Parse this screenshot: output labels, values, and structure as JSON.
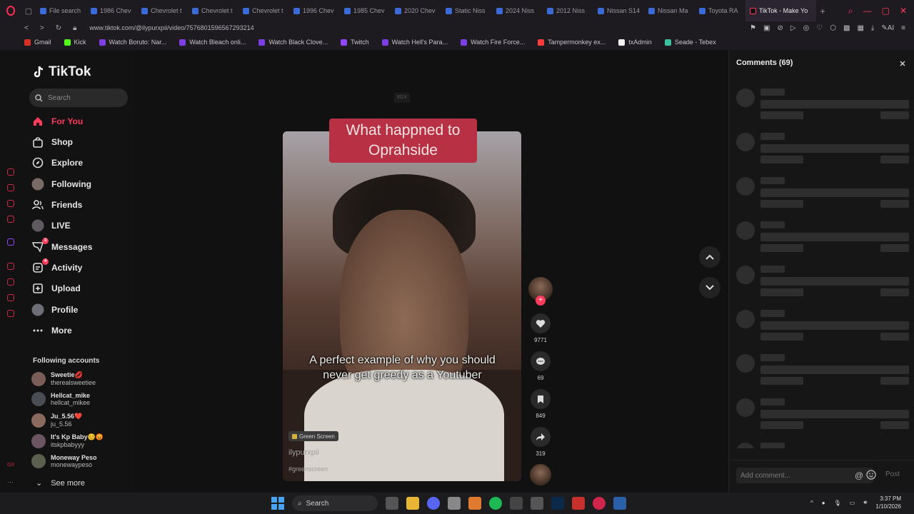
{
  "browser": {
    "tabs": [
      {
        "label": "File search"
      },
      {
        "label": "1986 Chev"
      },
      {
        "label": "Chevrolet t"
      },
      {
        "label": "Chevrolet t"
      },
      {
        "label": "Chevrolet t"
      },
      {
        "label": "1996 Chev"
      },
      {
        "label": "1985 Chev"
      },
      {
        "label": "2020 Chev"
      },
      {
        "label": "Static Niss"
      },
      {
        "label": "2024 Niss"
      },
      {
        "label": "2012 Niss"
      },
      {
        "label": "Nissan S14"
      },
      {
        "label": "Nissan Ma"
      },
      {
        "label": "Toyota RA"
      }
    ],
    "active_tab": "TikTok - Make Yo",
    "url": "www.tiktok.com/@ilypurxpii/video/7576801596567293214",
    "bookmarks": [
      {
        "label": "Gmail",
        "color": "#d93025"
      },
      {
        "label": "Kick",
        "color": "#53fc18"
      },
      {
        "label": "Watch Boruto: Nar...",
        "color": "#7b3fe4"
      },
      {
        "label": "Watch Bleach onli...",
        "color": "#7b3fe4"
      },
      {
        "label": "Watch Black Clove...",
        "color": "#7b3fe4"
      },
      {
        "label": "Twitch",
        "color": "#9146ff"
      },
      {
        "label": "Watch Hell's Para...",
        "color": "#7b3fe4"
      },
      {
        "label": "Watch Fire Force...",
        "color": "#7b3fe4"
      },
      {
        "label": "Tampermonkey ex...",
        "color": "#ff3b3b"
      },
      {
        "label": "txAdmin",
        "color": "#f2f2f2"
      },
      {
        "label": "Seade - Tebex",
        "color": "#3ec0a0"
      }
    ]
  },
  "tiktok": {
    "logo": "TikTok",
    "search_placeholder": "Search",
    "nav": [
      {
        "label": "For You",
        "icon": "home-icon"
      },
      {
        "label": "Shop",
        "icon": "shop-icon"
      },
      {
        "label": "Explore",
        "icon": "compass-icon"
      },
      {
        "label": "Following",
        "icon": "following-icon"
      },
      {
        "label": "Friends",
        "icon": "friends-icon"
      },
      {
        "label": "LIVE",
        "icon": "live-icon"
      },
      {
        "label": "Messages",
        "icon": "messages-icon",
        "badge": "3"
      },
      {
        "label": "Activity",
        "icon": "activity-icon",
        "badge": "4"
      },
      {
        "label": "Upload",
        "icon": "upload-icon"
      },
      {
        "label": "Profile",
        "icon": "profile-icon"
      },
      {
        "label": "More",
        "icon": "more-icon"
      }
    ],
    "following_header": "Following accounts",
    "following": [
      {
        "name": "Sweetie💋",
        "handle": "therealsweetiee"
      },
      {
        "name": "Hellcat_mike",
        "handle": "hellcat_mikee"
      },
      {
        "name": "Ju_5.56❤️",
        "handle": "ju_5.56"
      },
      {
        "name": "It's Kp Baby😊😡",
        "handle": "itskpbabyyy"
      },
      {
        "name": "Moneway Peso",
        "handle": "monewaypeso"
      }
    ],
    "see_more": "See more"
  },
  "video": {
    "watermark": "#GX",
    "title_card": "What happned to Oprahside",
    "caption": "A perfect example of why you should never get greedy as a Youtuber",
    "chip": "Green Screen",
    "username": "ilypurxpii",
    "hashtag": "#greenscreen",
    "likes": "9771",
    "comments": "69",
    "saves": "849",
    "shares": "319"
  },
  "comments_panel": {
    "title": "Comments (69)",
    "add_placeholder": "Add comment...",
    "at_symbol": "@",
    "post": "Post"
  },
  "taskbar": {
    "search": "Search",
    "time": "3:37 PM",
    "date": "1/10/2026"
  }
}
